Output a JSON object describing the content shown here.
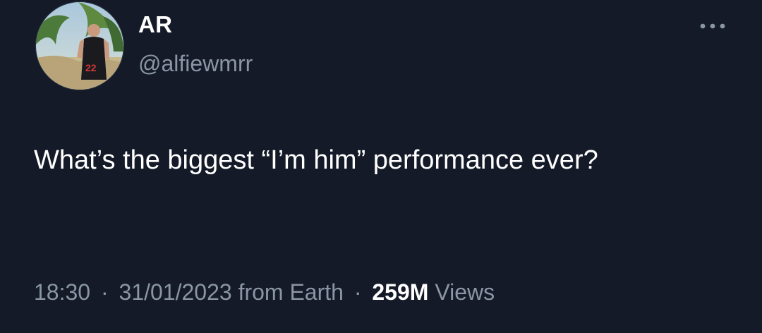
{
  "author": {
    "display_name": "AR",
    "handle": "@alfiewmrr",
    "avatar_icon": "avatar-photo-icon",
    "jersey_number": "22"
  },
  "tweet": {
    "text": "What’s the biggest “I’m him” performance ever?"
  },
  "meta": {
    "time": "18:30",
    "date": "31/01/2023",
    "source": "from Earth",
    "views_count": "259M",
    "views_label": "Views",
    "separator": "·"
  },
  "actions": {
    "more_icon": "more-options-icon"
  },
  "colors": {
    "background": "#141a27",
    "primary_text": "#ffffff",
    "secondary_text": "#8a95a5"
  }
}
